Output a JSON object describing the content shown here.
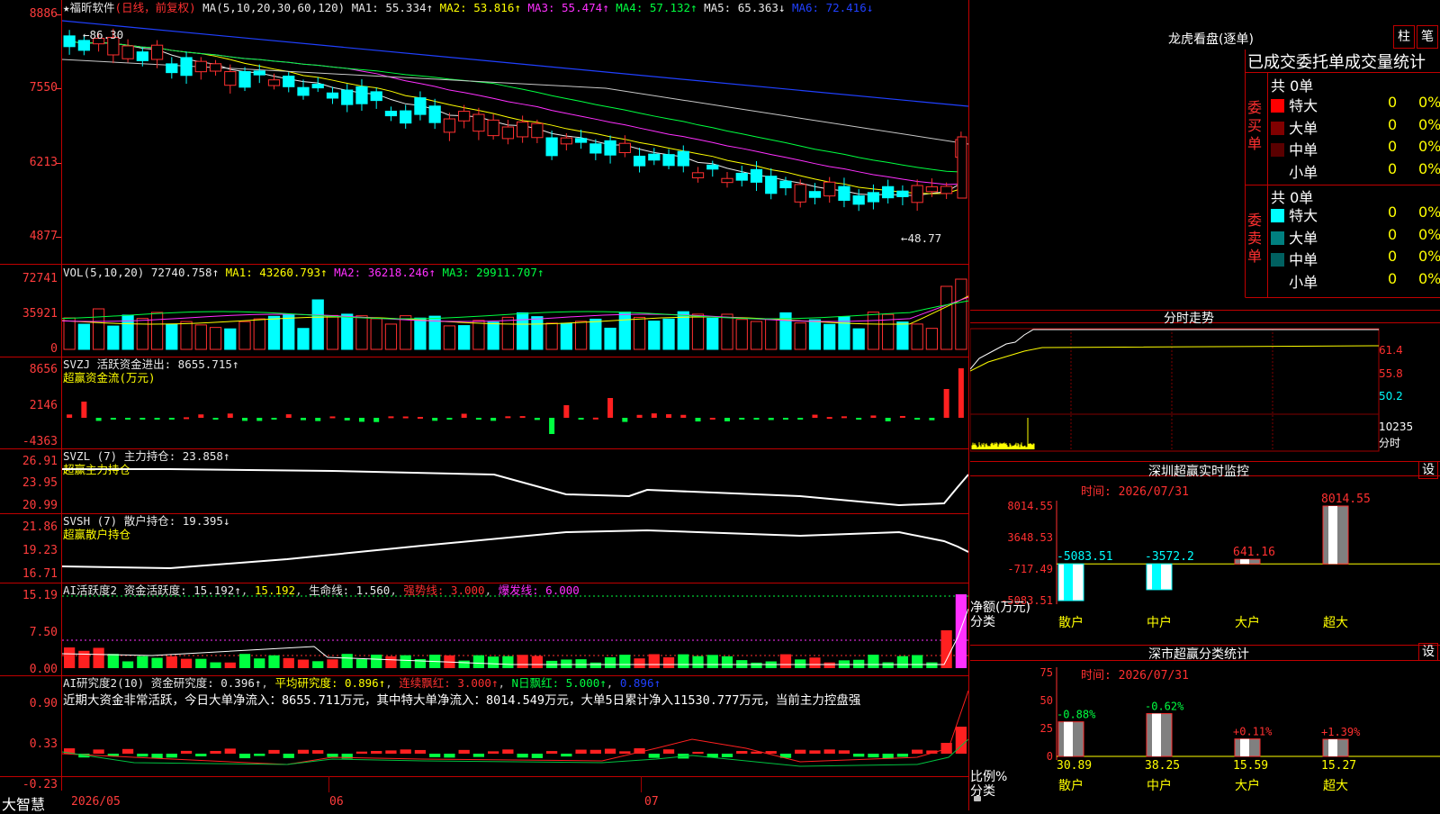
{
  "header": {
    "star": "★",
    "stock_name": "福昕软件",
    "period": "(日线，前复权)",
    "ma_label": "MA(5,10,20,30,60,120)",
    "ma1": "MA1: 55.334↑",
    "ma2": "MA2: 53.816↑",
    "ma3": "MA3: 55.474↑",
    "ma4": "MA4: 57.132↑",
    "ma5": "MA5: 65.363↓",
    "ma6": "MA6: 72.416↓"
  },
  "price_panel": {
    "y_ticks": [
      "8886",
      "7550",
      "6213",
      "4877"
    ],
    "high_label": "86.30",
    "low_label": "48.77"
  },
  "vol_panel": {
    "label": "VOL(5,10,20)",
    "value": "72740.758↑",
    "ma1": "MA1: 43260.793↑",
    "ma2": "MA2: 36218.246↑",
    "ma3": "MA3: 29911.707↑",
    "y_ticks": [
      "72741",
      "35921",
      "0"
    ]
  },
  "svzj_panel": {
    "label": "SVZJ  活跃资金进出: 8655.715↑",
    "sub": "超赢资金流(万元)",
    "y_ticks": [
      "8656",
      "2146",
      "-4363"
    ]
  },
  "svzl_panel": {
    "label": "SVZL (7) 主力持仓: 23.858↑",
    "sub": "超赢主力持仓",
    "y_ticks": [
      "26.91",
      "23.95",
      "20.99"
    ]
  },
  "svsh_panel": {
    "label": "SVSH (7) 散户持仓: 19.395↓",
    "sub": "超赢散户持仓",
    "y_ticks": [
      "21.86",
      "19.23",
      "16.71"
    ]
  },
  "ai1_panel": {
    "label": "AI活跃度2 资金活跃度: 15.192↑",
    "v2": "15.192",
    "v3": "生命线: 1.560",
    "v4": "强势线: 3.000",
    "v5": "爆发线: 6.000",
    "y_ticks": [
      "15.19",
      "7.50",
      "0.00"
    ]
  },
  "ai2_panel": {
    "label": "AI研究度2(10) 资金研究度: 0.396↑",
    "v2": "平均研究度: 0.896↑",
    "v3": "连续飘红: 3.000↑",
    "v4": "N日飘红: 5.000↑",
    "v5": "0.896↑",
    "commentary": "近期大资金非常活跃，今日大单净流入：8655.711万元，其中特大单净流入：8014.549万元，大单5日累计净入11530.777万元，当前主力控盘强",
    "y_ticks": [
      "0.90",
      "0.33",
      "-0.23"
    ]
  },
  "bottom_axis": {
    "app_name": "大智慧",
    "dates": [
      "2026/05",
      "06",
      "07"
    ]
  },
  "right_panel": {
    "longhu_title": "龙虎看盘(逐单)",
    "btn_zhu": "柱",
    "btn_bi": "笔",
    "table_title": "已成交委托单成交量统计",
    "buy_label": "委买单",
    "sell_label": "委卖单",
    "buy_total": "共 0单",
    "sell_total": "共 0单",
    "rows_buy": [
      {
        "name": "特大",
        "count": "0",
        "pct": "0%",
        "color": "#ff0000"
      },
      {
        "name": "大单",
        "count": "0",
        "pct": "0%",
        "color": "#800000"
      },
      {
        "name": "中单",
        "count": "0",
        "pct": "0%",
        "color": "#5a0000"
      },
      {
        "name": "小单",
        "count": "0",
        "pct": "0%",
        "color": "#000000"
      }
    ],
    "rows_sell": [
      {
        "name": "特大",
        "count": "0",
        "pct": "0%",
        "color": "#00ffff"
      },
      {
        "name": "大单",
        "count": "0",
        "pct": "0%",
        "color": "#008080"
      },
      {
        "name": "中单",
        "count": "0",
        "pct": "0%",
        "color": "#006060"
      },
      {
        "name": "小单",
        "count": "0",
        "pct": "0%",
        "color": "#000000"
      }
    ],
    "intraday_title": "分时走势",
    "intraday_ticks": [
      "61.4",
      "55.8",
      "50.2",
      "10235",
      "分时"
    ],
    "sz_monitor_title": "深圳超赢实时监控",
    "sz_monitor_btn": "设",
    "sz_monitor_time": "时间: 2026/07/31",
    "sz_monitor_yticks": [
      "8014.55",
      "3648.53",
      "-717.49",
      "-5083.51"
    ],
    "sz_monitor_side": "净额(万元)\n分类",
    "sz_class_title": "深市超赢分类统计",
    "sz_class_btn": "设",
    "sz_class_time": "时间: 2026/07/31",
    "sz_class_yticks": [
      "75",
      "50",
      "25",
      "0"
    ],
    "sz_class_side": "比例%\n分类"
  },
  "chart_data": [
    {
      "type": "bar",
      "title": "深圳超赢实时监控",
      "categories": [
        "散户",
        "中户",
        "大户",
        "超大"
      ],
      "values": [
        -5083.51,
        -3572.2,
        641.16,
        8014.55
      ],
      "value_labels": [
        "-5083.51",
        "-3572.2",
        "641.16",
        "8014.55"
      ],
      "ylabel": "净额(万元)",
      "ylim": [
        -5083.51,
        8014.55
      ]
    },
    {
      "type": "bar",
      "title": "深市超赢分类统计",
      "categories": [
        "散户",
        "中户",
        "大户",
        "超大"
      ],
      "values": [
        30.89,
        38.25,
        15.59,
        15.27
      ],
      "value_labels": [
        "30.89",
        "38.25",
        "15.59",
        "15.27"
      ],
      "change_labels": [
        "-0.88%",
        "-0.62%",
        "+0.11%",
        "+1.39%"
      ],
      "ylabel": "比例%",
      "ylim": [
        0,
        75
      ]
    }
  ]
}
